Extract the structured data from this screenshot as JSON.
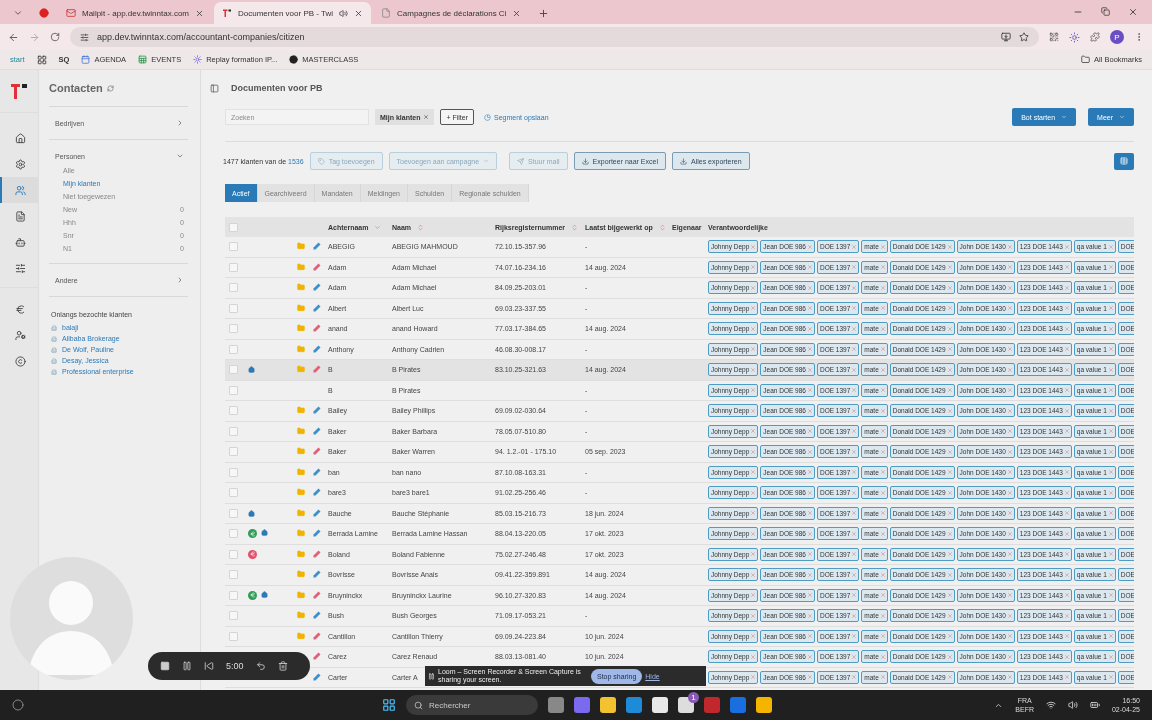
{
  "browser": {
    "tabs": [
      {
        "title": "Mailpit - app.dev.twinntax.com",
        "kind": "mail",
        "selected": false,
        "audio": false
      },
      {
        "title": "Documenten voor PB - Twi",
        "kind": "logo",
        "selected": true,
        "audio": true
      },
      {
        "title": "Campagnes de déclarations Ci",
        "kind": "page",
        "selected": false,
        "audio": false
      }
    ],
    "url": "app.dev.twinntax.com/accountant-companies/citizen",
    "profile": "P",
    "bookmarks": [
      {
        "label": "start",
        "kind": "start"
      },
      {
        "kind": "apps"
      },
      {
        "label": "SQ",
        "kind": "logo"
      },
      {
        "label": "AGENDA",
        "kind": "calendar"
      },
      {
        "label": "EVENTS",
        "kind": "sheet"
      },
      {
        "label": "Replay formation IP...",
        "kind": "gear"
      },
      {
        "label": "MASTERCLASS",
        "kind": "dark"
      }
    ],
    "all_bookmarks": "All Bookmarks"
  },
  "rail": {
    "groups": [
      [
        {
          "kind": "home",
          "selected": false
        },
        {
          "kind": "settings",
          "selected": false
        },
        {
          "kind": "contacts",
          "selected": true
        },
        {
          "kind": "list",
          "selected": false
        },
        {
          "kind": "robot",
          "selected": false
        },
        {
          "kind": "sliders",
          "selected": false
        }
      ],
      [
        {
          "kind": "euro",
          "selected": false
        },
        {
          "kind": "usergear",
          "selected": false
        },
        {
          "kind": "copyright",
          "selected": false
        }
      ]
    ]
  },
  "sidebar": {
    "title": "Contacten",
    "sections": [
      {
        "label": "Bedrijven",
        "expanded": false
      },
      {
        "label": "Personen",
        "expanded": true,
        "items": [
          {
            "label": "Alle",
            "selected": false
          },
          {
            "label": "Mijn klanten",
            "selected": true
          },
          {
            "label": "Niet toegewezen",
            "selected": false
          },
          {
            "label": "New",
            "count": "0",
            "selected": false
          },
          {
            "label": "Hhh",
            "count": "0",
            "selected": false
          },
          {
            "label": "Snr",
            "count": "0",
            "selected": false
          },
          {
            "label": "N1",
            "count": "0",
            "selected": false
          }
        ]
      },
      {
        "label": "Andere",
        "expanded": false
      }
    ],
    "recent": {
      "title": "Onlangs bezochte klanten",
      "items": [
        "balaji",
        "Alibaba Brokerage",
        "De Wolf, Pauline",
        "Desay, Jessica",
        "Professional enterprise"
      ]
    }
  },
  "page": {
    "title": "Documenten voor PB",
    "search": {
      "placeholder": "Zoeken"
    },
    "chips": [
      "Mijn klanten"
    ],
    "filter_button": "+ Filter",
    "segment_link": "Segment opslaan",
    "actions": [
      "Bot starten",
      "Meer"
    ],
    "count_text": "1477 klanten van de",
    "total": "1536",
    "toolbar": [
      {
        "label": "Tag toevoegen",
        "kind": "tag",
        "disabled": true
      },
      {
        "label": "Toevoegen aan campagne",
        "kind": "dropdown",
        "disabled": true
      },
      {
        "label": "Stuur mail",
        "kind": "send",
        "disabled": true
      },
      {
        "label": "Exporteer naar Excel",
        "kind": "download",
        "disabled": false
      },
      {
        "label": "Alles exporteren",
        "kind": "download",
        "disabled": false
      }
    ],
    "tabs": [
      {
        "label": "Actief",
        "selected": true
      },
      {
        "label": "Gearchiveerd",
        "selected": false
      },
      {
        "label": "Mandaten",
        "selected": false
      },
      {
        "label": "Meldingen",
        "selected": false
      },
      {
        "label": "Schulden",
        "selected": false
      },
      {
        "label": "Regionale schulden",
        "selected": false
      }
    ],
    "table": {
      "select_all": {
        "checked": false
      },
      "columns": [
        {
          "label": "Achternaam",
          "sortable": true,
          "sorted": true
        },
        {
          "label": "Naam",
          "sortable": true,
          "sorted": false
        },
        {
          "label": "Rijksregisternummer",
          "sortable": true,
          "sorted": false
        },
        {
          "label": "Laatst bijgewerkt op",
          "sortable": true,
          "sorted": false
        },
        {
          "label": "Eigenaar"
        },
        {
          "label": "Verantwoordelijke"
        }
      ],
      "rows": [
        {
          "achternaam": "ABEGIG",
          "naam": "ABEGIG MAHMOUD",
          "rijksregisternummer": "72.10.15-357.96",
          "laatst_bijgewerkt": "-",
          "badges": [],
          "folder": true,
          "edit": {
            "color": "#3f8fc9"
          },
          "highlighted": false,
          "verantwoordelijke": [
            "Johnny Depp",
            "Jean DOE 986",
            "DOE 1397",
            "mate",
            "Donald DOE 1429",
            "John DOE 1430",
            "123 DOE 1443",
            "qa value 1",
            "DOE"
          ]
        },
        {
          "achternaam": "Adam",
          "naam": "Adam Michael",
          "rijksregisternummer": "74.07.16-234.16",
          "laatst_bijgewerkt": "14 aug. 2024",
          "badges": [],
          "folder": true,
          "edit": {
            "color": "#e0607a"
          },
          "highlighted": false,
          "verantwoordelijke": [
            "Johnny Depp",
            "Jean DOE 986",
            "DOE 1397",
            "mate",
            "Donald DOE 1429",
            "John DOE 1430",
            "123 DOE 1443",
            "qa value 1",
            "DOE"
          ]
        },
        {
          "achternaam": "Adam",
          "naam": "Adam Michael",
          "rijksregisternummer": "84.09.25-203.01",
          "laatst_bijgewerkt": "-",
          "badges": [],
          "folder": true,
          "edit": {
            "color": "#3f8fc9"
          },
          "highlighted": false,
          "verantwoordelijke": [
            "Johnny Depp",
            "Jean DOE 986",
            "DOE 1397",
            "mate",
            "Donald DOE 1429",
            "John DOE 1430",
            "123 DOE 1443",
            "qa value 1",
            "DOE"
          ]
        },
        {
          "achternaam": "Albert",
          "naam": "Albert Luc",
          "rijksregisternummer": "69.03.23-337.55",
          "laatst_bijgewerkt": "-",
          "badges": [],
          "folder": true,
          "edit": {
            "color": "#3f8fc9"
          },
          "highlighted": false,
          "verantwoordelijke": [
            "Johnny Depp",
            "Jean DOE 986",
            "DOE 1397",
            "mate",
            "Donald DOE 1429",
            "John DOE 1430",
            "123 DOE 1443",
            "qa value 1",
            "DOE"
          ]
        },
        {
          "achternaam": "anand",
          "naam": "anand Howard",
          "rijksregisternummer": "77.03.17-384.65",
          "laatst_bijgewerkt": "14 aug. 2024",
          "badges": [],
          "folder": true,
          "edit": {
            "color": "#e0607a"
          },
          "highlighted": false,
          "verantwoordelijke": [
            "Johnny Depp",
            "Jean DOE 986",
            "DOE 1397",
            "mate",
            "Donald DOE 1429",
            "John DOE 1430",
            "123 DOE 1443",
            "qa value 1",
            "DOE"
          ]
        },
        {
          "achternaam": "Anthony",
          "naam": "Anthony Cadrien",
          "rijksregisternummer": "46.08.30-008.17",
          "laatst_bijgewerkt": "-",
          "badges": [],
          "folder": true,
          "edit": {
            "color": "#3f8fc9"
          },
          "highlighted": false,
          "verantwoordelijke": [
            "Johnny Depp",
            "Jean DOE 986",
            "DOE 1397",
            "mate",
            "Donald DOE 1429",
            "John DOE 1430",
            "123 DOE 1443",
            "qa value 1",
            "DOE"
          ]
        },
        {
          "achternaam": "B",
          "naam": "B Pirates",
          "rijksregisternummer": "83.10.25-321.63",
          "laatst_bijgewerkt": "14 aug. 2024",
          "badges": [
            {
              "kind": "home"
            }
          ],
          "folder": true,
          "edit": {
            "color": "#e0607a"
          },
          "highlighted": true,
          "verantwoordelijke": [
            "Johnny Depp",
            "Jean DOE 986",
            "DOE 1397",
            "mate",
            "Donald DOE 1429",
            "John DOE 1430",
            "123 DOE 1443",
            "qa value 1",
            "DOE"
          ]
        },
        {
          "achternaam": "B",
          "naam": "B Pirates",
          "laatst_bijgewerkt": "-",
          "badges": [],
          "folder": false,
          "highlighted": false,
          "verantwoordelijke": [
            "Johnny Depp",
            "Jean DOE 986",
            "DOE 1397",
            "mate",
            "Donald DOE 1429",
            "John DOE 1430",
            "123 DOE 1443",
            "qa value 1",
            "DOE"
          ]
        },
        {
          "achternaam": "Bailey",
          "naam": "Bailey Phillips",
          "rijksregisternummer": "69.09.02-030.64",
          "laatst_bijgewerkt": "-",
          "badges": [],
          "folder": true,
          "edit": {
            "color": "#3f8fc9"
          },
          "highlighted": false,
          "verantwoordelijke": [
            "Johnny Depp",
            "Jean DOE 986",
            "DOE 1397",
            "mate",
            "Donald DOE 1429",
            "John DOE 1430",
            "123 DOE 1443",
            "qa value 1",
            "DOE"
          ]
        },
        {
          "achternaam": "Baker",
          "naam": "Baker Barbara",
          "rijksregisternummer": "78.05.07-510.80",
          "laatst_bijgewerkt": "-",
          "badges": [],
          "folder": true,
          "edit": {
            "color": "#3f8fc9"
          },
          "highlighted": false,
          "verantwoordelijke": [
            "Johnny Depp",
            "Jean DOE 986",
            "DOE 1397",
            "mate",
            "Donald DOE 1429",
            "John DOE 1430",
            "123 DOE 1443",
            "qa value 1",
            "DOE"
          ]
        },
        {
          "achternaam": "Baker",
          "naam": "Baker Warren",
          "rijksregisternummer": "94. 1.2.-01 - 175.10",
          "laatst_bijgewerkt": "05 sep. 2023",
          "badges": [],
          "folder": true,
          "edit": {
            "color": "#e0607a"
          },
          "highlighted": false,
          "verantwoordelijke": [
            "Johnny Depp",
            "Jean DOE 986",
            "DOE 1397",
            "mate",
            "Donald DOE 1429",
            "John DOE 1430",
            "123 DOE 1443",
            "qa value 1",
            "DOE"
          ]
        },
        {
          "achternaam": "ban",
          "naam": "ban nano",
          "rijksregisternummer": "87.10.08-163.31",
          "laatst_bijgewerkt": "-",
          "badges": [],
          "folder": true,
          "edit": {
            "color": "#3f8fc9"
          },
          "highlighted": false,
          "verantwoordelijke": [
            "Johnny Depp",
            "Jean DOE 986",
            "DOE 1397",
            "mate",
            "Donald DOE 1429",
            "John DOE 1430",
            "123 DOE 1443",
            "qa value 1",
            "DOE"
          ]
        },
        {
          "achternaam": "bare3",
          "naam": "bare3 bare1",
          "rijksregisternummer": "91.02.25-256.46",
          "laatst_bijgewerkt": "-",
          "badges": [],
          "folder": true,
          "edit": {
            "color": "#3f8fc9"
          },
          "highlighted": false,
          "verantwoordelijke": [
            "Johnny Depp",
            "Jean DOE 986",
            "DOE 1397",
            "mate",
            "Donald DOE 1429",
            "John DOE 1430",
            "123 DOE 1443",
            "qa value 1",
            "DOE"
          ]
        },
        {
          "achternaam": "Bauche",
          "naam": "Bauche Stéphanie",
          "rijksregisternummer": "85.03.15-216.73",
          "laatst_bijgewerkt": "18 jun. 2024",
          "badges": [
            {
              "kind": "home"
            }
          ],
          "folder": true,
          "edit": {
            "color": "#3f8fc9"
          },
          "highlighted": false,
          "verantwoordelijke": [
            "Johnny Depp",
            "Jean DOE 986",
            "DOE 1397",
            "mate",
            "Donald DOE 1429",
            "John DOE 1430",
            "123 DOE 1443",
            "qa value 1",
            "DOE"
          ]
        },
        {
          "achternaam": "Berrada Lamine",
          "naam": "Berrada Lamine Hassan",
          "rijksregisternummer": "88.04.13-220.05",
          "laatst_bijgewerkt": "17 okt. 2023",
          "badges": [
            {
              "kind": "euro",
              "color": "#2f9e55"
            },
            {
              "kind": "home"
            }
          ],
          "folder": true,
          "edit": {
            "color": "#3f8fc9"
          },
          "highlighted": false,
          "verantwoordelijke": [
            "Johnny Depp",
            "Jean DOE 986",
            "DOE 1397",
            "mate",
            "Donald DOE 1429",
            "John DOE 1430",
            "123 DOE 1443",
            "qa value 1",
            "DOE"
          ]
        },
        {
          "achternaam": "Boland",
          "naam": "Boland Fabienne",
          "rijksregisternummer": "75.02.27-246.48",
          "laatst_bijgewerkt": "17 okt. 2023",
          "badges": [
            {
              "kind": "euro",
              "color": "#e0506a"
            }
          ],
          "folder": true,
          "edit": {
            "color": "#e0607a"
          },
          "highlighted": false,
          "verantwoordelijke": [
            "Johnny Depp",
            "Jean DOE 986",
            "DOE 1397",
            "mate",
            "Donald DOE 1429",
            "John DOE 1430",
            "123 DOE 1443",
            "qa value 1",
            "DOE"
          ]
        },
        {
          "achternaam": "Bovrisse",
          "naam": "Bovrisse Anais",
          "rijksregisternummer": "09.41.22-359.891",
          "laatst_bijgewerkt": "14 aug. 2024",
          "badges": [],
          "folder": true,
          "edit": {
            "color": "#3f8fc9"
          },
          "highlighted": false,
          "verantwoordelijke": [
            "Johnny Depp",
            "Jean DOE 986",
            "DOE 1397",
            "mate",
            "Donald DOE 1429",
            "John DOE 1430",
            "123 DOE 1443",
            "qa value 1",
            "DOE"
          ]
        },
        {
          "achternaam": "Bruyninckx",
          "naam": "Bruyninckx Laurine",
          "rijksregisternummer": "96.10.27-320.83",
          "laatst_bijgewerkt": "14 aug. 2024",
          "badges": [
            {
              "kind": "euro",
              "color": "#2f9e55"
            },
            {
              "kind": "home"
            }
          ],
          "folder": true,
          "edit": {
            "color": "#e0607a"
          },
          "highlighted": false,
          "verantwoordelijke": [
            "Johnny Depp",
            "Jean DOE 986",
            "DOE 1397",
            "mate",
            "Donald DOE 1429",
            "John DOE 1430",
            "123 DOE 1443",
            "qa value 1",
            "DOE"
          ]
        },
        {
          "achternaam": "Bush",
          "naam": "Bush Georges",
          "rijksregisternummer": "71.09.17-053.21",
          "laatst_bijgewerkt": "-",
          "badges": [],
          "folder": true,
          "edit": {
            "color": "#3f8fc9"
          },
          "highlighted": false,
          "verantwoordelijke": [
            "Johnny Depp",
            "Jean DOE 986",
            "DOE 1397",
            "mate",
            "Donald DOE 1429",
            "John DOE 1430",
            "123 DOE 1443",
            "qa value 1",
            "DOE"
          ]
        },
        {
          "achternaam": "Cantillon",
          "naam": "Cantillon Thierry",
          "rijksregisternummer": "69.09.24-223.84",
          "laatst_bijgewerkt": "10 jun. 2024",
          "badges": [],
          "folder": true,
          "edit": {
            "color": "#e0607a"
          },
          "highlighted": false,
          "verantwoordelijke": [
            "Johnny Depp",
            "Jean DOE 986",
            "DOE 1397",
            "mate",
            "Donald DOE 1429",
            "John DOE 1430",
            "123 DOE 1443",
            "qa value 1",
            "DOE"
          ]
        },
        {
          "achternaam": "Carez",
          "selectable": false,
          "naam": "Carez Renaud",
          "rijksregisternummer": "88.03.13-081.40",
          "laatst_bijgewerkt": "10 jun. 2024",
          "badges": [],
          "folder": false,
          "edit": {
            "color": "#e0607a"
          },
          "highlighted": false,
          "verantwoordelijke": [
            "Johnny Depp",
            "Jean DOE 986",
            "DOE 1397",
            "mate",
            "Donald DOE 1429",
            "John DOE 1430",
            "123 DOE 1443",
            "qa value 1",
            "DOE"
          ]
        },
        {
          "achternaam": "Carter",
          "selectable": false,
          "naam": "Carter A",
          "badges": [],
          "folder": false,
          "edit": {
            "color": "#3f8fc9"
          },
          "highlighted": false,
          "verantwoordelijke": [
            "Johnny Depp",
            "Jean DOE 986",
            "DOE 1397",
            "mate",
            "Donald DOE 1429",
            "John DOE 1430",
            "123 DOE 1443",
            "qa value 1",
            "DOE"
          ]
        }
      ]
    }
  },
  "loom": {
    "timer": "5:00",
    "notice": "Loom – Screen Recorder & Screen Capture is sharing your screen.",
    "stop": "Stop sharing",
    "hide": "Hide"
  },
  "taskbar": {
    "search": "Rechercher",
    "store_badge": "1",
    "language": "FRA",
    "region": "BEFR",
    "time": "16:50",
    "date": "02-04-25"
  }
}
